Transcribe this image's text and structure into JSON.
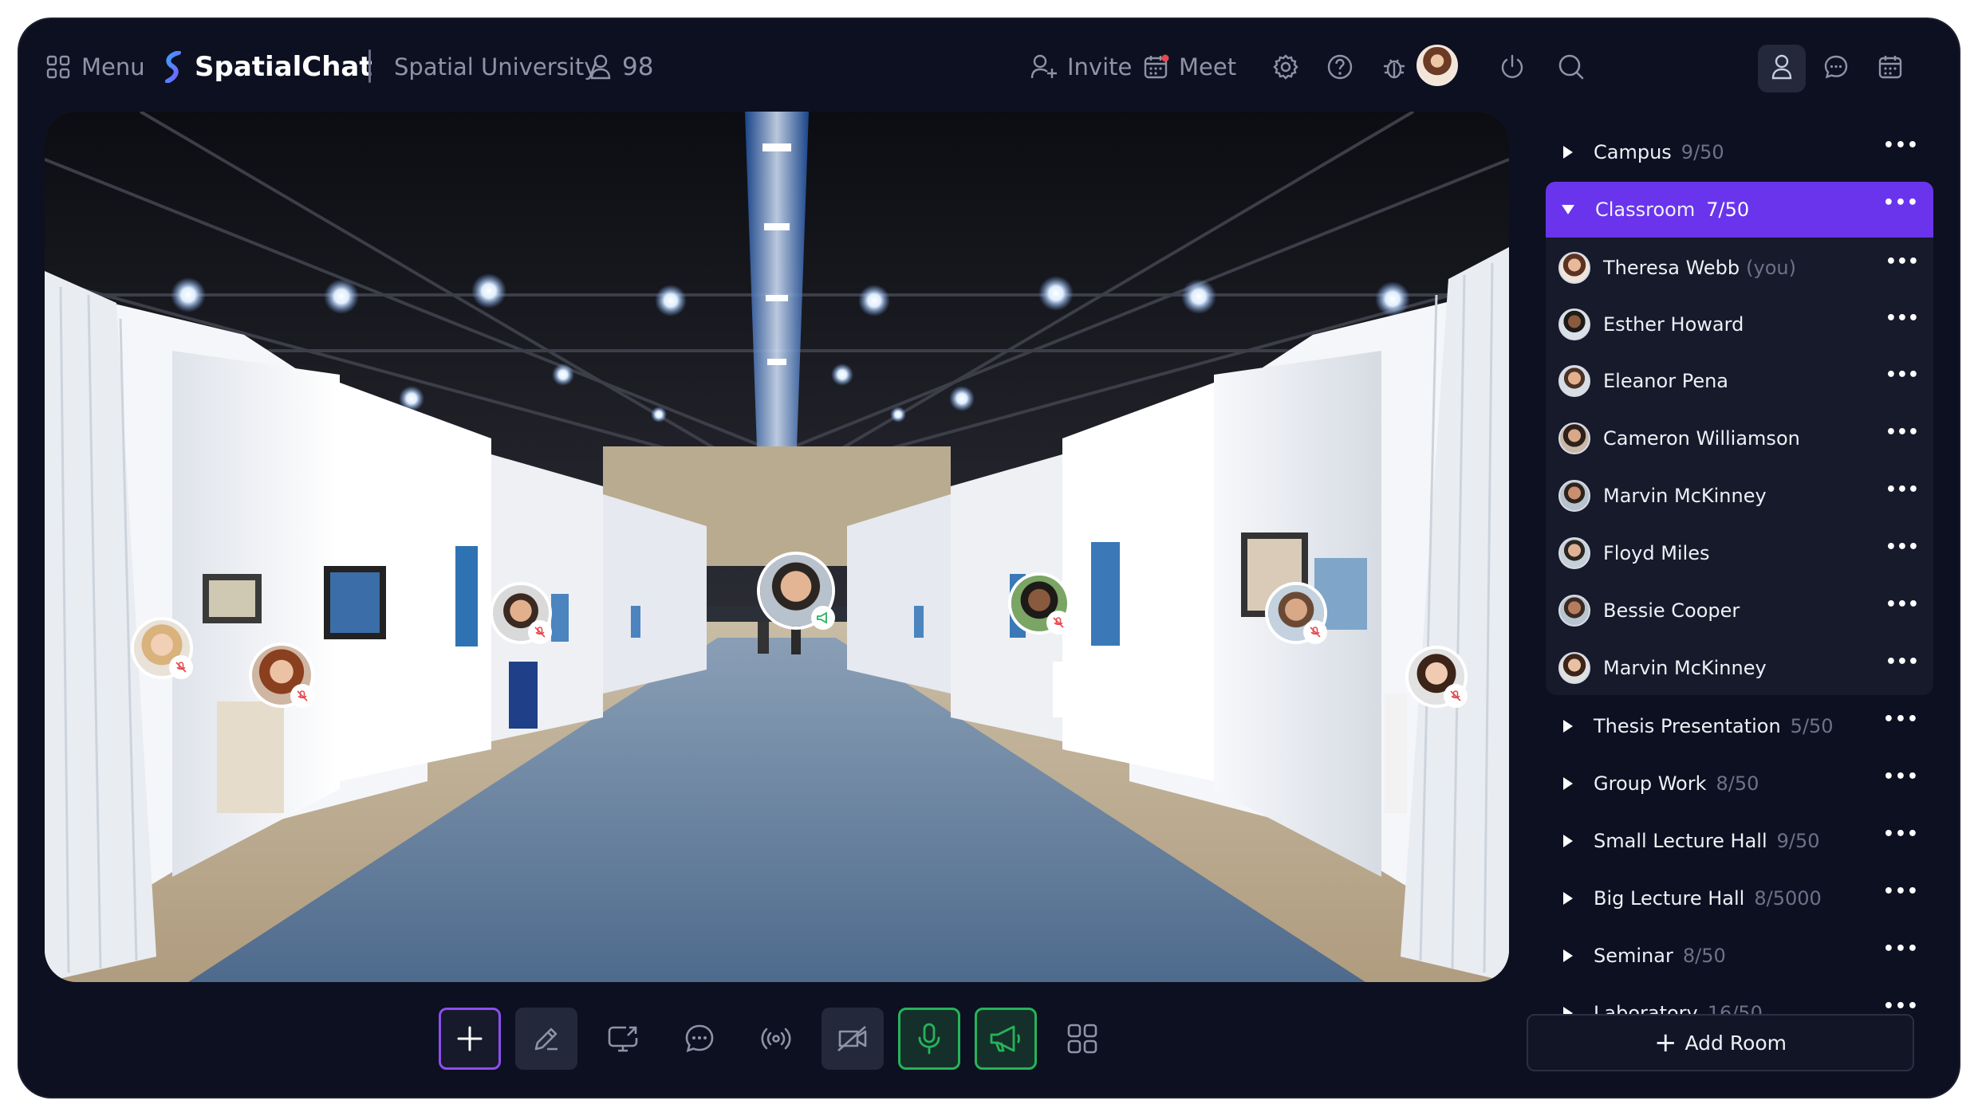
{
  "topbar": {
    "menu_label": "Menu",
    "brand_name": "SpatialChat",
    "org_name": "Spatial University",
    "user_count": "98",
    "invite_label": "Invite",
    "meet_label": "Meet"
  },
  "rooms_top": [
    {
      "name": "Campus",
      "count": "9/50"
    }
  ],
  "active_room": {
    "name": "Classroom",
    "count": "7/50"
  },
  "members": [
    {
      "name": "Theresa Webb",
      "suffix": "(you)"
    },
    {
      "name": "Esther Howard",
      "suffix": ""
    },
    {
      "name": "Eleanor Pena",
      "suffix": ""
    },
    {
      "name": "Cameron Williamson",
      "suffix": ""
    },
    {
      "name": "Marvin McKinney",
      "suffix": ""
    },
    {
      "name": "Floyd Miles",
      "suffix": ""
    },
    {
      "name": "Bessie Cooper",
      "suffix": ""
    },
    {
      "name": "Marvin McKinney",
      "suffix": ""
    }
  ],
  "rooms_bottom": [
    {
      "name": "Thesis Presentation",
      "count": "5/50"
    },
    {
      "name": "Group Work",
      "count": "8/50"
    },
    {
      "name": "Small Lecture Hall",
      "count": "9/50"
    },
    {
      "name": "Big Lecture Hall",
      "count": "8/5000"
    },
    {
      "name": "Seminar",
      "count": "8/50"
    },
    {
      "name": "Laboratory",
      "count": "16/50"
    }
  ],
  "more_glyph": "•••",
  "add_room_label": "Add Room",
  "colors": {
    "window_bg": "#0d1020",
    "accent_purple": "#6a34ec",
    "active_green": "#26b35a",
    "muted_text": "#8e93a6",
    "mic_off_red": "#e5484d"
  },
  "icons": {
    "menu": "grid-icon",
    "brand": "spatialchat-logo",
    "user_count": "person-icon",
    "invite": "person-add-icon",
    "meet": "calendar-icon",
    "settings": "gear-icon",
    "help": "question-icon",
    "bug": "bug-icon",
    "power": "power-icon",
    "search": "search-icon",
    "people_tab": "person-icon",
    "chat_tab": "chat-icon",
    "schedule_tab": "calendar-icon"
  },
  "toolbar_icons": [
    "plus-icon",
    "pencil-icon",
    "screen-share-icon",
    "chat-icon",
    "broadcast-icon",
    "camera-off-icon",
    "microphone-icon",
    "megaphone-icon",
    "apps-grid-icon"
  ]
}
